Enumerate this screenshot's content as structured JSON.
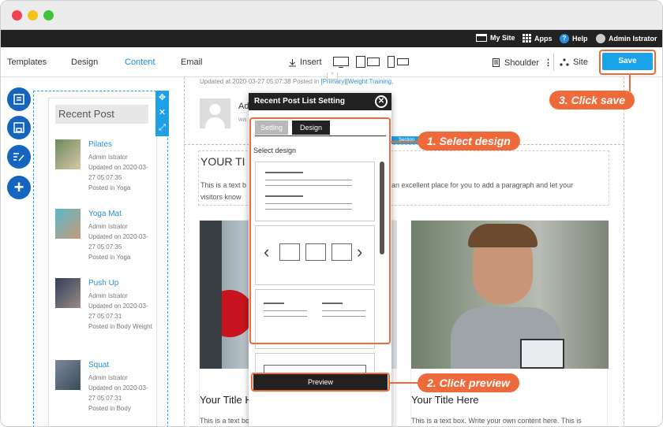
{
  "topbar": {
    "mysite": "My Site",
    "apps": "Apps",
    "help": "Help",
    "user": "Admin Istrator"
  },
  "toolbar": {
    "templates": "Templates",
    "design": "Design",
    "content": "Content",
    "email": "Email",
    "insert": "Insert",
    "shoulder": "Shoulder",
    "site": "Site",
    "save": "Save"
  },
  "meta": {
    "updated": "Updated at 2020-03-27 05:07:38 Posted in",
    "categories": "[Primary][Weight Training,"
  },
  "sidebar": {
    "title": "Recent Post",
    "posts": [
      {
        "name": "Pilates",
        "author": "Admin Istrator",
        "updated": "Updated on 2020-03-27 05:07:35",
        "posted": "Posted in Yoga"
      },
      {
        "name": "Yoga Mat",
        "author": "Admin Istrator",
        "updated": "Updated on 2020-03-27 05:07:35",
        "posted": "Posted in Yoga"
      },
      {
        "name": "Push Up",
        "author": "Admin Istrator",
        "updated": "Updated on 2020-03-27 05:07:31",
        "posted": "Posted in Body Weight"
      },
      {
        "name": "Squat",
        "author": "Admin Istrator",
        "updated": "Updated on 2020-03-27 05:07:31",
        "posted": "Posted in Body"
      }
    ]
  },
  "dialog": {
    "title": "Recent Post List Setting",
    "tab_setting": "Setting",
    "tab_design": "Design",
    "select_label": "Select design",
    "preview": "Preview"
  },
  "content": {
    "heading": "YOUR TI",
    "textA": "This is a text b",
    "textB": "an excellent place for you to add a paragraph and let your",
    "textC": "visitors know",
    "card_title": "Your Title Here",
    "card_text": "This is a text box. Write your own content here. This is"
  },
  "callouts": {
    "c1": "1. Select design",
    "c2": "2. Click preview",
    "c3": "3. Click save"
  },
  "colors": {
    "accent": "#ef6a3a",
    "save": "#1aa3e8",
    "link": "#2a8fd6",
    "topbar": "#222222"
  }
}
